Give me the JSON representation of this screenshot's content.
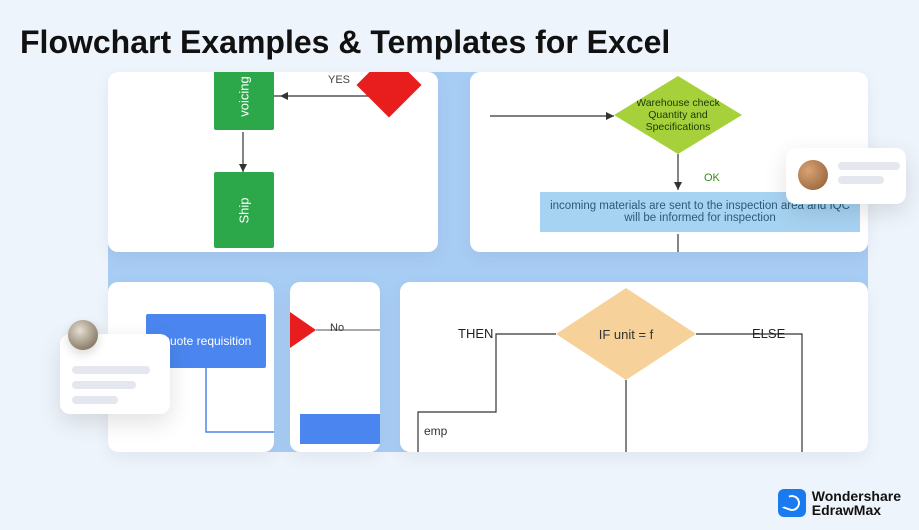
{
  "title": "Flowchart  Examples & Templates for Excel",
  "tl": {
    "box1": "voicing",
    "box2": "Ship",
    "yes": "YES"
  },
  "tr": {
    "diamond": "Warehouse check Quantity and Specifications",
    "ok": "OK",
    "inspection": "incoming materials are sent to the inspection area and IQC will be informed for inspection"
  },
  "bl": {
    "block": "Quote requisition"
  },
  "bm": {
    "no": "No"
  },
  "br": {
    "then": "THEN",
    "cond": "IF unit = f",
    "else": "ELSE",
    "emp": "emp"
  },
  "brand": {
    "line1": "Wondershare",
    "line2": "EdrawMax"
  }
}
